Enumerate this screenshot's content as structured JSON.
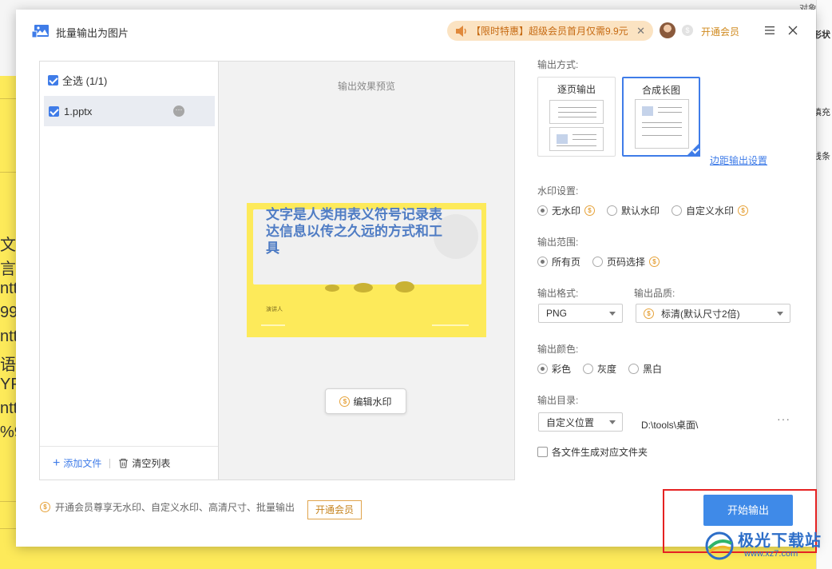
{
  "background": {
    "right_panel_title": "对象属性",
    "right_panel_items": [
      "形状",
      "填充",
      "线条"
    ],
    "doc_fragments": [
      "文",
      "言",
      "ntt",
      "99",
      "ntt",
      "语",
      "YP",
      "ntt",
      "%9"
    ]
  },
  "dialog": {
    "title": "批量输出为图片",
    "promo_text": "【限时特惠】超级会员首月仅需9.9元",
    "vip_link": "开通会员"
  },
  "files": {
    "select_all_label": "全选 (1/1)",
    "items": [
      {
        "name": "1.pptx",
        "checked": true
      }
    ],
    "add_file_label": "添加文件",
    "clear_list_label": "清空列表"
  },
  "preview": {
    "title": "输出效果预览",
    "slide_title": "文字是人类用表义符号记录表达信息以传之久远的方式和工具",
    "slide_presenter": "演讲人",
    "edit_watermark_label": "编辑水印"
  },
  "settings": {
    "output_mode_label": "输出方式:",
    "modes": [
      {
        "label": "逐页输出",
        "selected": false
      },
      {
        "label": "合成长图",
        "selected": true
      }
    ],
    "margin_link": "边距输出设置",
    "watermark_label": "水印设置:",
    "watermark_options": [
      {
        "label": "无水印",
        "selected": true,
        "vip": true
      },
      {
        "label": "默认水印",
        "selected": false,
        "vip": false
      },
      {
        "label": "自定义水印",
        "selected": false,
        "vip": true
      }
    ],
    "range_label": "输出范围:",
    "range_options": [
      {
        "label": "所有页",
        "selected": true,
        "vip": false
      },
      {
        "label": "页码选择",
        "selected": false,
        "vip": true
      }
    ],
    "format_label": "输出格式:",
    "format_value": "PNG",
    "quality_label": "输出品质:",
    "quality_value": "标清(默认尺寸2倍)",
    "color_label": "输出颜色:",
    "color_options": [
      {
        "label": "彩色",
        "selected": true
      },
      {
        "label": "灰度",
        "selected": false
      },
      {
        "label": "黑白",
        "selected": false
      }
    ],
    "directory_label": "输出目录:",
    "directory_mode": "自定义位置",
    "directory_path": "D:\\tools\\桌面\\",
    "subfolder_label": "各文件生成对应文件夹",
    "subfolder_checked": false
  },
  "footer": {
    "vip_note": "开通会员尊享无水印、自定义水印、高清尺寸、批量输出",
    "vip_button": "开通会员",
    "start_button": "开始输出"
  },
  "site_logo": {
    "name": "极光下载站",
    "url": "www.xz7.com"
  },
  "colors": {
    "accent": "#3f8ae8",
    "highlight": "#e52222",
    "slide_bg": "#fdea5a",
    "vip_gold": "#e6a33c"
  }
}
